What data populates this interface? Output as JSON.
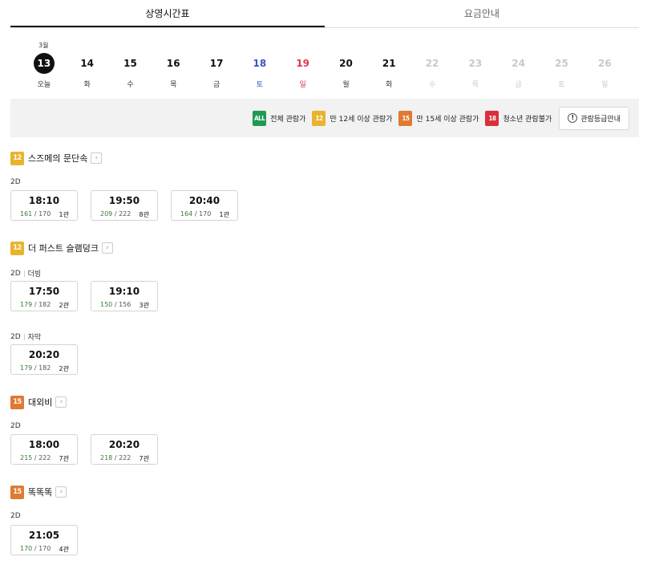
{
  "tabs": [
    {
      "label": "상영시간표",
      "active": true
    },
    {
      "label": "요금안내",
      "active": false
    }
  ],
  "month": "3월",
  "dates": [
    {
      "day": "13",
      "dow": "오늘",
      "type": "today"
    },
    {
      "day": "14",
      "dow": "화",
      "type": "weekday"
    },
    {
      "day": "15",
      "dow": "수",
      "type": "weekday"
    },
    {
      "day": "16",
      "dow": "목",
      "type": "weekday"
    },
    {
      "day": "17",
      "dow": "금",
      "type": "weekday"
    },
    {
      "day": "18",
      "dow": "토",
      "type": "sat"
    },
    {
      "day": "19",
      "dow": "일",
      "type": "sun"
    },
    {
      "day": "20",
      "dow": "월",
      "type": "weekday"
    },
    {
      "day": "21",
      "dow": "화",
      "type": "weekday"
    },
    {
      "day": "22",
      "dow": "수",
      "type": "disabled"
    },
    {
      "day": "23",
      "dow": "목",
      "type": "disabled"
    },
    {
      "day": "24",
      "dow": "금",
      "type": "disabled"
    },
    {
      "day": "25",
      "dow": "토",
      "type": "disabled"
    },
    {
      "day": "26",
      "dow": "일",
      "type": "disabled"
    }
  ],
  "legend": {
    "items": [
      {
        "badge": "ALL",
        "class": "r-all",
        "label": "전체 관람가"
      },
      {
        "badge": "12",
        "class": "r-12",
        "label": "만 12세 이상 관람가"
      },
      {
        "badge": "15",
        "class": "r-15",
        "label": "만 15세 이상 관람가"
      },
      {
        "badge": "18",
        "class": "r-18",
        "label": "청소년 관람불가"
      }
    ],
    "guide_button": "관람등급안내",
    "guide_icon": "!"
  },
  "movies": [
    {
      "rating": "12",
      "rating_class": "r-12",
      "title": "스즈메의 문단속",
      "groups": [
        {
          "format": "2D",
          "sub": "",
          "times": [
            {
              "time": "18:10",
              "avail": "161",
              "total": "170",
              "hall": "1관"
            },
            {
              "time": "19:50",
              "avail": "209",
              "total": "222",
              "hall": "8관"
            },
            {
              "time": "20:40",
              "avail": "164",
              "total": "170",
              "hall": "1관"
            }
          ]
        }
      ]
    },
    {
      "rating": "12",
      "rating_class": "r-12",
      "title": "더 퍼스트 슬램덩크",
      "groups": [
        {
          "format": "2D",
          "sub": "더빙",
          "times": [
            {
              "time": "17:50",
              "avail": "179",
              "total": "182",
              "hall": "2관"
            },
            {
              "time": "19:10",
              "avail": "150",
              "total": "156",
              "hall": "3관"
            }
          ]
        },
        {
          "format": "2D",
          "sub": "자막",
          "times": [
            {
              "time": "20:20",
              "avail": "179",
              "total": "182",
              "hall": "2관"
            }
          ]
        }
      ]
    },
    {
      "rating": "15",
      "rating_class": "r-15",
      "title": "대외비",
      "groups": [
        {
          "format": "2D",
          "sub": "",
          "times": [
            {
              "time": "18:00",
              "avail": "215",
              "total": "222",
              "hall": "7관"
            },
            {
              "time": "20:20",
              "avail": "218",
              "total": "222",
              "hall": "7관"
            }
          ]
        }
      ]
    },
    {
      "rating": "15",
      "rating_class": "r-15",
      "title": "똑똑똑",
      "groups": [
        {
          "format": "2D",
          "sub": "",
          "times": [
            {
              "time": "21:05",
              "avail": "170",
              "total": "170",
              "hall": "4관"
            }
          ]
        }
      ]
    }
  ],
  "arrow_icon": "chevron-right-icon",
  "colors": {
    "rating_all": "#1f9a52",
    "rating_12": "#e9b32f",
    "rating_15": "#e07a32",
    "rating_18": "#d8303b",
    "saturday": "#3b52c4",
    "sunday": "#e0344c"
  }
}
